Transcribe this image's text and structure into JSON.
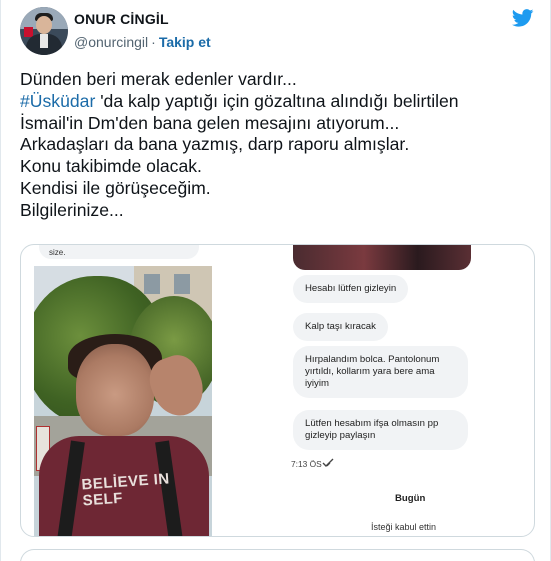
{
  "author": {
    "name": "ONUR CİNGİL",
    "handle": "@onurcingil",
    "separator": "·",
    "follow_label": "Takip et"
  },
  "brand": {
    "icon": "twitter-bird-icon",
    "color": "#1d9bf0"
  },
  "tweet": {
    "lines": [
      "Dünden beri merak edenler vardır...",
      "'da kalp yaptığı için gözaltına alındığı belirtilen",
      "İsmail'in Dm'den bana gelen mesajını atıyorum...",
      "Arkadaşları da bana yazmış, darp raporu almışlar.",
      "Konu takibimde olacak.",
      "Kendisi ile görüşeceğim.",
      "Bilgilerinize..."
    ],
    "hashtag": "#Üsküdar",
    "hashtag_color": "#1b6ba8"
  },
  "media": {
    "top_chip": "size.",
    "photo_shirt_text": "BELİEVE IN SELF",
    "messages": [
      "Hesabı lütfen gizleyin",
      "Kalp taşı kıracak",
      "Hırpalandım bolca. Pantolonum yırtıldı, kollarım yara bere ama iyiyim",
      "Lütfen hesabım ifşa olmasın pp gizleyip paylaşın"
    ],
    "time": "7:13 ÖS",
    "day_divider": "Bugün",
    "request_status": "İsteği kabul ettin"
  }
}
